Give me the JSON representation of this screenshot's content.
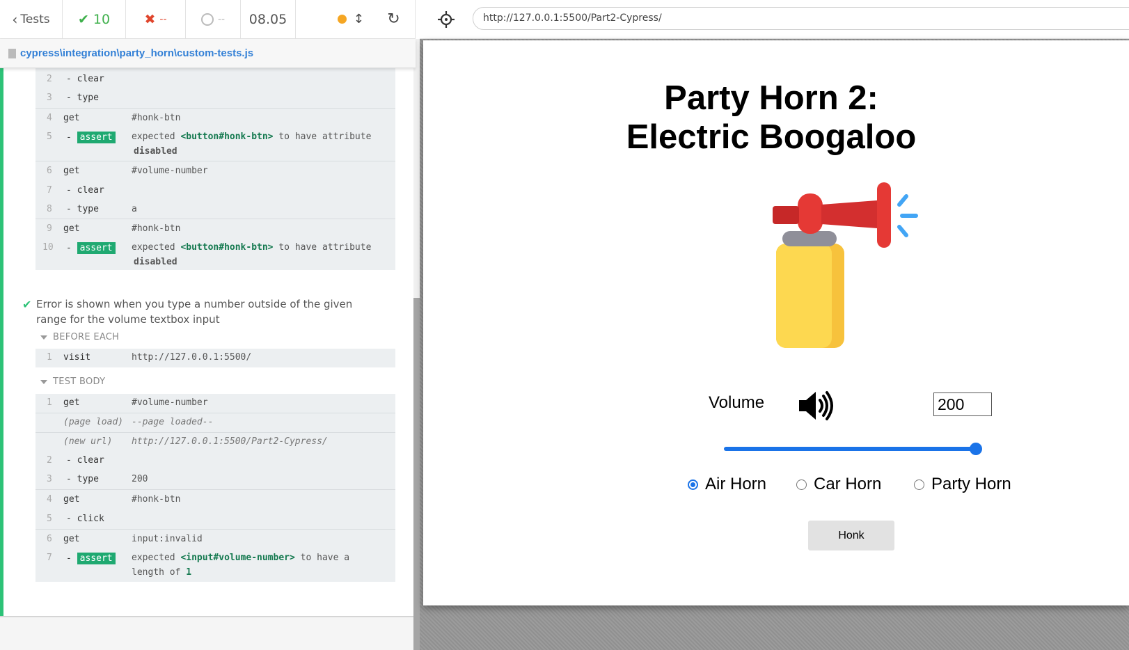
{
  "reporter": {
    "topbar": {
      "tests_label": "Tests",
      "passed_count": "10",
      "failed_count": "--",
      "pending_count": "--",
      "duration": "08.05"
    },
    "spec_path": "cypress\\integration\\party_horn\\custom-tests.js",
    "previous_test_commands": [
      {
        "num": "2",
        "name": "- clear",
        "msg": ""
      },
      {
        "num": "3",
        "name": "- type",
        "msg": ""
      },
      {
        "num": "4",
        "name": "get",
        "msg": "#honk-btn"
      },
      {
        "num": "5",
        "name": "- ",
        "badge": "assert",
        "msg_pre": "expected ",
        "msg_el": "<button#honk-btn>",
        "msg_post": " to have attribute",
        "msg_line2": "disabled"
      },
      {
        "num": "6",
        "name": "get",
        "msg": "#volume-number"
      },
      {
        "num": "7",
        "name": "- clear",
        "msg": ""
      },
      {
        "num": "8",
        "name": "- type",
        "msg": "a"
      },
      {
        "num": "9",
        "name": "get",
        "msg": "#honk-btn"
      },
      {
        "num": "10",
        "name": "- ",
        "badge": "assert",
        "msg_pre": "expected ",
        "msg_el": "<button#honk-btn>",
        "msg_post": " to have attribute",
        "msg_line2": "disabled"
      }
    ],
    "test": {
      "title_line1": "Error is shown when you type a number outside of the given",
      "title_line2": "range for the volume textbox input",
      "before_each_label": "BEFORE EACH",
      "before_each_commands": [
        {
          "num": "1",
          "name": "visit",
          "msg": "http://127.0.0.1:5500/"
        }
      ],
      "test_body_label": "TEST BODY",
      "test_body_commands": [
        {
          "num": "1",
          "name": "get",
          "msg": "#volume-number"
        },
        {
          "num": "",
          "name": "(page load)",
          "msg": "--page loaded--"
        },
        {
          "num": "",
          "name": "(new url)",
          "msg": "http://127.0.0.1:5500/Part2-Cypress/"
        },
        {
          "num": "2",
          "name": "- clear",
          "msg": ""
        },
        {
          "num": "3",
          "name": "- type",
          "msg": "200"
        },
        {
          "num": "4",
          "name": "get",
          "msg": "#honk-btn"
        },
        {
          "num": "5",
          "name": "- click",
          "msg": ""
        },
        {
          "num": "6",
          "name": "get",
          "msg": "input:invalid"
        },
        {
          "num": "7",
          "name": "- ",
          "badge": "assert",
          "msg_pre": "expected ",
          "msg_el": "<input#volume-number>",
          "msg_post": " to have a",
          "msg_line2_pre": "length of ",
          "msg_line2": "1"
        }
      ]
    }
  },
  "aut": {
    "url": "http://127.0.0.1:5500/Part2-Cypress/",
    "title_line1": "Party Horn 2:",
    "title_line2": "Electric Boogaloo",
    "volume_label": "Volume",
    "volume_value": "200",
    "slider_value": 100,
    "radio_options": [
      {
        "label": "Air Horn",
        "checked": true
      },
      {
        "label": "Car Horn",
        "checked": false
      },
      {
        "label": "Party Horn",
        "checked": false
      }
    ],
    "honk_label": "Honk",
    "icons": {
      "horn": "air-horn-icon",
      "volume": "volume-high-icon"
    },
    "colors": {
      "pass": "#2dc277",
      "fail": "#e0452c",
      "link": "#3380d6",
      "assert_badge": "#1fa971",
      "slider": "#1a73e8"
    }
  }
}
